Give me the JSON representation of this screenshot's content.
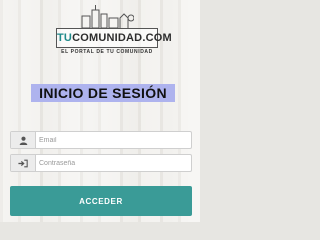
{
  "logo": {
    "brand_tu": "TU",
    "brand_rest": "COMUNIDAD.COM",
    "tagline": "EL PORTAL DE TU COMUNIDAD"
  },
  "login": {
    "title": "INICIO DE SESIÓN",
    "email_placeholder": "Email",
    "password_placeholder": "Contraseña",
    "submit_label": "ACCEDER"
  },
  "icons": {
    "email_field": "user-icon",
    "password_field": "sign-in-icon"
  },
  "colors": {
    "title_highlight": "#aeb3ee",
    "button": "#3a9b97",
    "brand_accent": "#1f8a8a"
  }
}
